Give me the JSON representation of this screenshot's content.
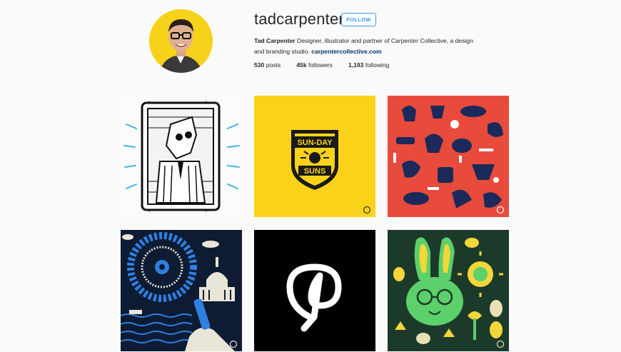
{
  "profile": {
    "username": "tadcarpenter",
    "follow_label": "FOLLOW",
    "full_name": "Tad Carpenter",
    "bio_line1": "Designer, illustrator and partner of Carpenter Collective, a design",
    "bio_line2": "and branding studio.",
    "website": "carpentercollective.com"
  },
  "stats": {
    "posts_count": "530",
    "posts_label": "posts",
    "followers_count": "45k",
    "followers_label": "followers",
    "following_count": "1,193",
    "following_label": "following"
  },
  "posts": [
    {
      "id": "post-1",
      "subject": "framed-character-illustration"
    },
    {
      "id": "post-2",
      "subject": "sun-day-suns-badge",
      "text_top": "SUN-DAY",
      "text_bottom": "SUNS"
    },
    {
      "id": "post-3",
      "subject": "food-and-rooster-pattern"
    },
    {
      "id": "post-4",
      "subject": "capitol-ferris-wheel-night"
    },
    {
      "id": "post-5",
      "subject": "pinterest-logo"
    },
    {
      "id": "post-6",
      "subject": "green-bunny-easter"
    }
  ],
  "colors": {
    "accent": "#3897f0",
    "link": "#003569",
    "avatar_bg": "#f7d21b",
    "tile_yellow": "#fbd21a",
    "tile_red": "#e84a3b",
    "tile_navy": "#1b2a5a",
    "tile_black": "#000000",
    "tile_green": "#1c3a2a"
  }
}
